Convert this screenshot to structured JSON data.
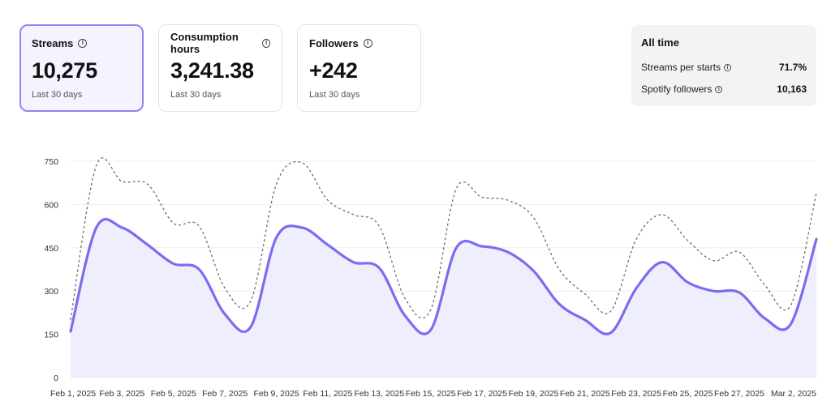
{
  "cards": [
    {
      "title": "Streams",
      "value": "10,275",
      "period": "Last 30 days",
      "selected": true
    },
    {
      "title": "Consumption hours",
      "value": "3,241.38",
      "period": "Last 30 days",
      "selected": false
    },
    {
      "title": "Followers",
      "value": "+242",
      "period": "Last 30 days",
      "selected": false
    }
  ],
  "all_time": {
    "title": "All time",
    "rows": [
      {
        "label": "Streams per starts",
        "value": "71.7%"
      },
      {
        "label": "Spotify followers",
        "value": "10,163"
      }
    ]
  },
  "icons": {
    "info": "info-icon"
  },
  "colors": {
    "accent": "#7b6cf0",
    "area_fill": "#efeefd",
    "comparison": "#6f6f6f",
    "selected_border": "#8b87ee"
  },
  "chart_data": {
    "type": "line",
    "x": [
      "Feb 1",
      "Feb 2",
      "Feb 3",
      "Feb 4",
      "Feb 5",
      "Feb 6",
      "Feb 7",
      "Feb 8",
      "Feb 9",
      "Feb 10",
      "Feb 11",
      "Feb 12",
      "Feb 13",
      "Feb 14",
      "Feb 15",
      "Feb 16",
      "Feb 17",
      "Feb 18",
      "Feb 19",
      "Feb 20",
      "Feb 21",
      "Feb 22",
      "Feb 23",
      "Feb 24",
      "Feb 25",
      "Feb 26",
      "Feb 27",
      "Feb 28",
      "Mar 1",
      "Mar 2"
    ],
    "x_tick_labels": [
      "Feb 1, 2025",
      "Feb 3, 2025",
      "Feb 5, 2025",
      "Feb 7, 2025",
      "Feb 9, 2025",
      "Feb 11, 2025",
      "Feb 13, 2025",
      "Feb 15, 2025",
      "Feb 17, 2025",
      "Feb 19, 2025",
      "Feb 21, 2025",
      "Feb 23, 2025",
      "Feb 25, 2025",
      "Feb 27, 2025",
      "Mar 2, 2025"
    ],
    "y_ticks": [
      0,
      150,
      300,
      450,
      600,
      750
    ],
    "ylim": [
      0,
      750
    ],
    "grid": true,
    "series": [
      {
        "style": "solid-area",
        "values": [
          160,
          520,
          520,
          460,
          395,
          375,
          220,
          175,
          485,
          520,
          460,
          400,
          380,
          215,
          165,
          450,
          455,
          435,
          370,
          255,
          200,
          155,
          310,
          400,
          330,
          300,
          295,
          205,
          185,
          480
        ]
      },
      {
        "style": "dashed",
        "values": [
          200,
          735,
          680,
          670,
          535,
          525,
          310,
          265,
          670,
          745,
          615,
          565,
          525,
          275,
          235,
          655,
          625,
          615,
          555,
          375,
          290,
          230,
          480,
          565,
          475,
          405,
          435,
          320,
          250,
          640
        ]
      }
    ]
  }
}
